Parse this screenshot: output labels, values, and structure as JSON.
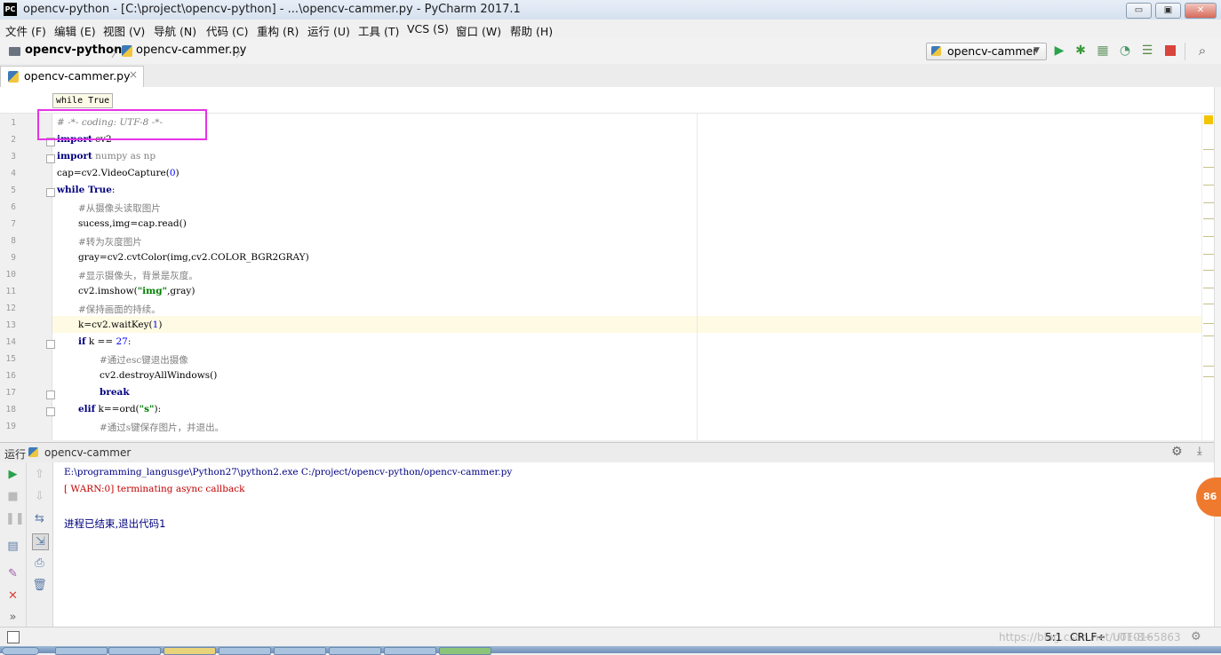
{
  "window": {
    "app_icon_text": "PC",
    "title": "opencv-python - [C:\\project\\opencv-python] - ...\\opencv-cammer.py - PyCharm 2017.1",
    "min": "▭",
    "max": "▣",
    "close": "✕"
  },
  "menu": [
    "文件 (F)",
    "编辑 (E)",
    "视图 (V)",
    "导航 (N)",
    "代码 (C)",
    "重构 (R)",
    "运行 (U)",
    "工具 (T)",
    "VCS (S)",
    "窗口 (W)",
    "帮助 (H)"
  ],
  "nav": {
    "project": "opencv-python",
    "file": "opencv-cammer.py",
    "run_config": "opencv-cammer"
  },
  "tabs": [
    {
      "label": "opencv-cammer.py",
      "close": "×"
    }
  ],
  "breadcrumb": "while True",
  "code_lines": [
    {
      "n": "1"
    },
    {
      "n": "2"
    },
    {
      "n": "3"
    },
    {
      "n": "4"
    },
    {
      "n": "5"
    },
    {
      "n": "6"
    },
    {
      "n": "7"
    },
    {
      "n": "8"
    },
    {
      "n": "9"
    },
    {
      "n": "10"
    },
    {
      "n": "11"
    },
    {
      "n": "12"
    },
    {
      "n": "13"
    },
    {
      "n": "14"
    },
    {
      "n": "15"
    },
    {
      "n": "16"
    },
    {
      "n": "17"
    },
    {
      "n": "18"
    },
    {
      "n": "19"
    }
  ],
  "code": {
    "l1": "# -*- coding: UTF-8 -*-",
    "l2_kw": "import",
    "l2_rest": " cv2",
    "l3_kw": "import",
    "l3_rest": " numpy as np",
    "l4_a": "cap=cv2.VideoCapture(",
    "l4_num": "0",
    "l4_b": ")",
    "l5_kw": "while True",
    "l5_rest": ":",
    "l6": "#从摄像头读取图片",
    "l7": "sucess,img=cap.read()",
    "l8": "#转为灰度图片",
    "l9": "gray=cv2.cvtColor(img,cv2.COLOR_BGR2GRAY)",
    "l10": "#显示摄像头，背景是灰度。",
    "l11_a": "cv2.imshow(",
    "l11_str": "\"img\"",
    "l11_b": ",gray)",
    "l12": "#保持画面的持续。",
    "l13_a": "k=cv2.waitKey(",
    "l13_num": "1",
    "l13_b": ")",
    "l14_kw": "if",
    "l14_a": " k == ",
    "l14_num": "27",
    "l14_b": ":",
    "l15": "#通过esc键退出摄像",
    "l16": "cv2.destroyAllWindows()",
    "l17_kw": "break",
    "l18_kw": "elif",
    "l18_a": " k==ord(",
    "l18_str": "\"s\"",
    "l18_b": "):",
    "l19": "#通过s键保存图片，并退出。"
  },
  "run_panel": {
    "title": "运行",
    "config": "opencv-cammer",
    "gear": "⚙",
    "pin": "⤓"
  },
  "console": {
    "cmd": "E:\\programming_langusge\\Python27\\python2.exe C:/project/opencv-python/opencv-cammer.py",
    "warn": "[ WARN:0] terminating async callback",
    "exit": "进程已结束,退出代码1"
  },
  "status": {
    "position": "5:1",
    "line_sep": "CRLF÷",
    "encoding": "UTF-8÷",
    "watermark": "https://blog.csdn.net/u010165863"
  },
  "badge": "86",
  "colors": {
    "keyword": "#000080",
    "comment": "#808080",
    "number": "#0000ff",
    "string": "#008000",
    "highlight_box": "#e633e6",
    "warn": "#c00000"
  }
}
